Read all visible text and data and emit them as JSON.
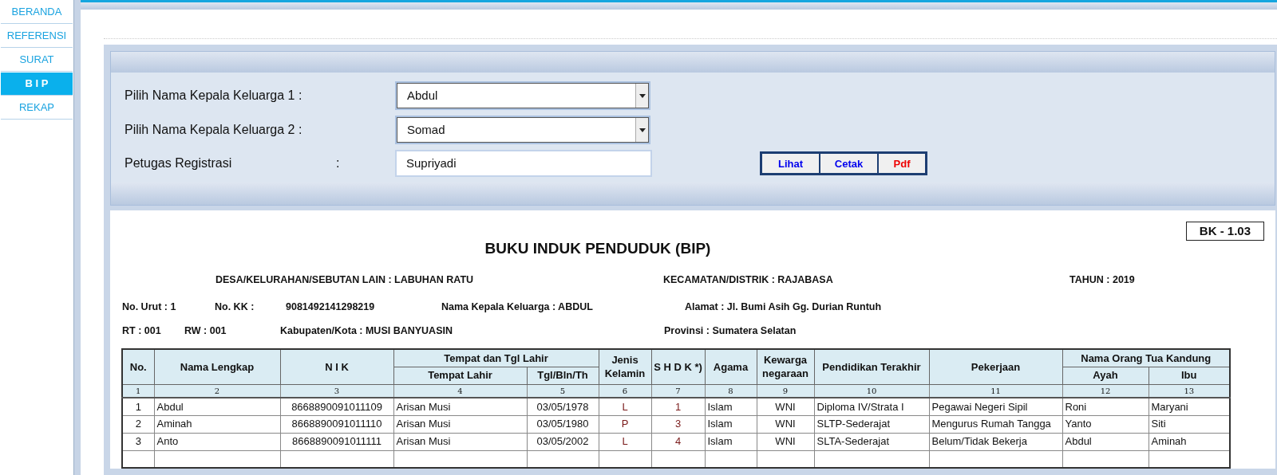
{
  "sidebar": {
    "items": [
      {
        "label": "BERANDA",
        "selected": false
      },
      {
        "label": "REFERENSI",
        "selected": false
      },
      {
        "label": "SURAT",
        "selected": false
      },
      {
        "label": "B I P",
        "selected": true
      },
      {
        "label": "REKAP",
        "selected": false
      }
    ]
  },
  "form": {
    "selects": [
      {
        "label": "Pilih Nama Kepala Keluarga 1 :",
        "value": "Abdul"
      },
      {
        "label": "Pilih Nama Kepala Keluarga 2 :",
        "value": "Somad"
      }
    ],
    "petugas": {
      "label": "Petugas Registrasi",
      "colon": ":",
      "value": "Supriyadi"
    },
    "buttons": [
      {
        "label": "Lihat",
        "color": "#0000ee"
      },
      {
        "label": "Cetak",
        "color": "#0000ee"
      },
      {
        "label": "Pdf",
        "color": "#ee0000"
      }
    ]
  },
  "report": {
    "code": "BK - 1.03",
    "title": "BUKU INDUK PENDUDUK (BIP)",
    "info_rows": [
      [
        "DESA/KELURAHAN/SEBUTAN LAIN : LABUHAN RATU",
        "KECAMATAN/DISTRIK : RAJABASA",
        "TAHUN : 2019"
      ],
      [
        "No. Urut : 1",
        "No. KK :",
        "9081492141298219",
        "Nama Kepala Keluarga : ABDUL",
        "Alamat : Jl. Bumi Asih Gg. Durian Runtuh"
      ],
      [
        "RT : 001",
        "RW : 001",
        "Kabupaten/Kota : MUSI BANYUASIN",
        "Provinsi : Sumatera Selatan"
      ]
    ],
    "table": {
      "columns": [
        {
          "label": "No."
        },
        {
          "label": "Nama Lengkap"
        },
        {
          "label": "N I K"
        },
        {
          "label": "Tempat dan Tgl Lahir",
          "colspan": 2,
          "children": [
            "Tempat Lahir",
            "Tgl/Bln/Th"
          ]
        },
        {
          "label": "Jenis Kelamin"
        },
        {
          "label": "S H D K *)"
        },
        {
          "label": "Agama"
        },
        {
          "label": "Kewarga negaraan"
        },
        {
          "label": "Pendidikan Terakhir"
        },
        {
          "label": "Pekerjaan"
        },
        {
          "label": "Nama Orang Tua Kandung",
          "colspan": 2,
          "children": [
            "Ayah",
            "Ibu"
          ]
        }
      ],
      "numbers": [
        "1",
        "2",
        "3",
        "4",
        "5",
        "6",
        "7",
        "8",
        "9",
        "10",
        "11",
        "12",
        "13"
      ],
      "rows": [
        [
          "1",
          "Abdul",
          "8668890091011109",
          "Arisan Musi",
          "03/05/1978",
          "L",
          "1",
          "Islam",
          "WNI",
          "Diploma IV/Strata I",
          "Pegawai Negeri Sipil",
          "Roni",
          "Maryani"
        ],
        [
          "2",
          "Aminah",
          "8668890091011110",
          "Arisan Musi",
          "03/05/1980",
          "P",
          "3",
          "Islam",
          "WNI",
          "SLTP-Sederajat",
          "Mengurus Rumah Tangga",
          "Yanto",
          "Siti"
        ],
        [
          "3",
          "Anto",
          "8668890091011111",
          "Arisan Musi",
          "03/05/2002",
          "L",
          "4",
          "Islam",
          "WNI",
          "SLTA-Sederajat",
          "Belum/Tidak Bekerja",
          "Abdul",
          "Aminah"
        ]
      ]
    }
  }
}
